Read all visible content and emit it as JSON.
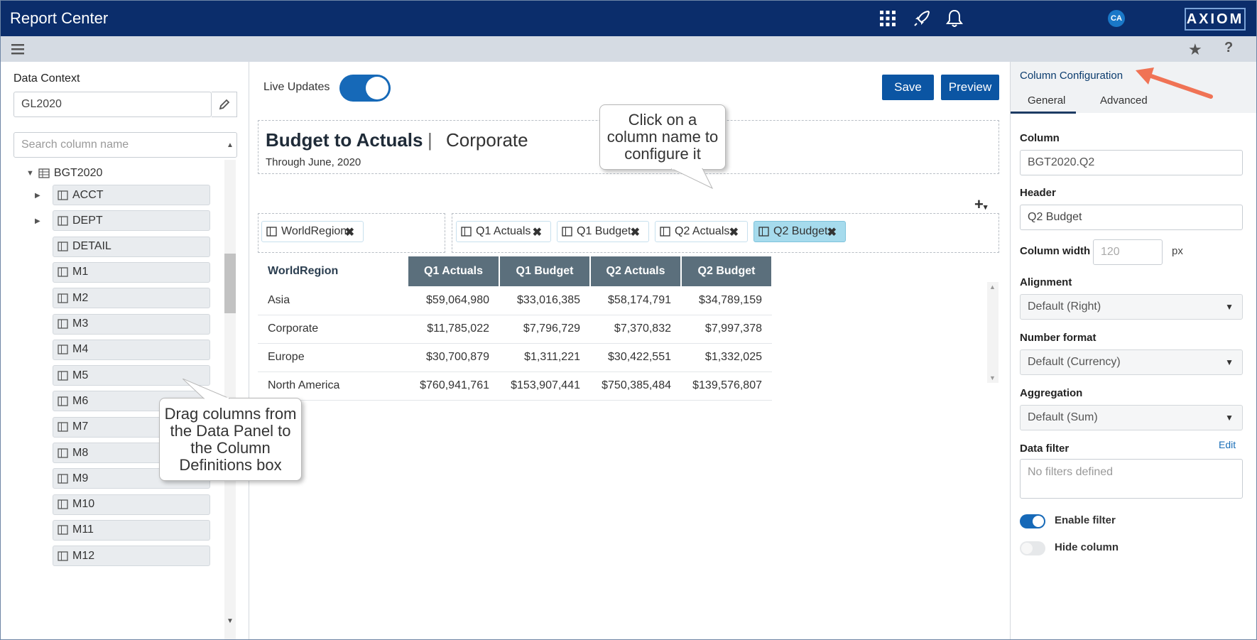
{
  "app": {
    "title": "Report Center",
    "user_initials": "CA",
    "logo": "AXIOM"
  },
  "topbar_icons": [
    "apps-grid-icon",
    "rocket-icon",
    "bell-icon"
  ],
  "left_panel": {
    "data_context_label": "Data Context",
    "data_context_value": "GL2020",
    "search_placeholder": "Search column name",
    "tree_root": "BGT2020",
    "items": [
      "ACCT",
      "DEPT",
      "DETAIL",
      "M1",
      "M2",
      "M3",
      "M4",
      "M5",
      "M6",
      "M7",
      "M8",
      "M9",
      "M10",
      "M11",
      "M12"
    ]
  },
  "toolbar": {
    "live_updates_label": "Live Updates",
    "live_updates_on": true,
    "save_label": "Save",
    "preview_label": "Preview"
  },
  "report": {
    "title": "Budget to Actuals",
    "separator": "|",
    "subtitle": "Corporate",
    "date_line": "Through June, 2020"
  },
  "row_definitions": [
    "WorldRegion"
  ],
  "column_definitions": [
    "Q1 Actuals",
    "Q1 Budget",
    "Q2 Actuals",
    "Q2 Budget"
  ],
  "selected_column": "Q2 Budget",
  "grid": {
    "row_header": "WorldRegion",
    "columns": [
      "Q1 Actuals",
      "Q1 Budget",
      "Q2 Actuals",
      "Q2 Budget"
    ],
    "rows": [
      {
        "label": "Asia",
        "values": [
          "$59,064,980",
          "$33,016,385",
          "$58,174,791",
          "$34,789,159"
        ]
      },
      {
        "label": "Corporate",
        "values": [
          "$11,785,022",
          "$7,796,729",
          "$7,370,832",
          "$7,997,378"
        ]
      },
      {
        "label": "Europe",
        "values": [
          "$30,700,879",
          "$1,311,221",
          "$30,422,551",
          "$1,332,025"
        ]
      },
      {
        "label": "North America",
        "values": [
          "$760,941,761",
          "$153,907,441",
          "$750,385,484",
          "$139,576,807"
        ]
      }
    ]
  },
  "config_panel": {
    "title": "Column Configuration",
    "tabs": [
      "General",
      "Advanced"
    ],
    "active_tab": "General",
    "column_label": "Column",
    "column_value": "BGT2020.Q2",
    "header_label": "Header",
    "header_value": "Q2 Budget",
    "width_label": "Column width",
    "width_placeholder": "120",
    "width_unit": "px",
    "alignment_label": "Alignment",
    "alignment_value": "Default (Right)",
    "number_format_label": "Number format",
    "number_format_value": "Default (Currency)",
    "aggregation_label": "Aggregation",
    "aggregation_value": "Default (Sum)",
    "data_filter_label": "Data filter",
    "data_filter_edit": "Edit",
    "data_filter_placeholder": "No filters defined",
    "enable_filter_label": "Enable filter",
    "enable_filter_on": true,
    "hide_column_label": "Hide column",
    "hide_column_on": false
  },
  "callouts": {
    "column_name": "Click on a column name to configure it",
    "drag_columns": "Drag columns from the Data Panel to the Column Definitions box"
  },
  "colors": {
    "nav": "#0b2d6b",
    "accent": "#0b55a3",
    "header_cell": "#5b6f7c",
    "selected_chip": "#a6dbed",
    "arrow": "#f07355"
  }
}
